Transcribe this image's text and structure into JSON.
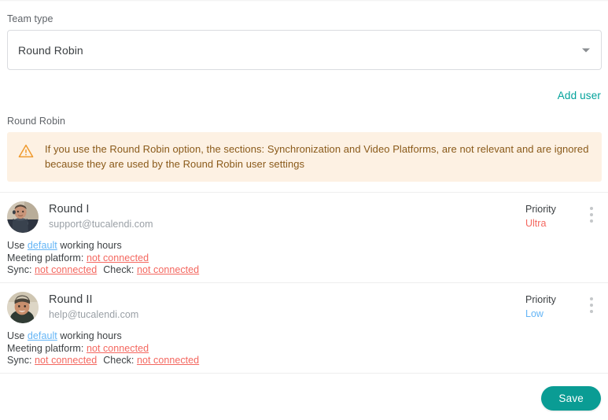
{
  "colors": {
    "accent_teal": "#0a9c94",
    "link_teal": "#00a19a",
    "warning_bg": "#fdf1e3",
    "warning_text": "#8a5a1a",
    "warning_icon": "#ef9a2e",
    "danger": "#f4675f",
    "info_blue": "#64b5f6",
    "muted": "#9aa0a6",
    "border": "#dadce0"
  },
  "team_type": {
    "label": "Team type",
    "selected": "Round Robin",
    "options": [
      "Round Robin"
    ],
    "arrow_icon": "chevron-down-icon"
  },
  "actions": {
    "add_user_label": "Add user"
  },
  "section": {
    "title": "Round Robin"
  },
  "warning": {
    "icon": "warning-triangle-icon",
    "text": "If you use the Round Robin option, the sections: Synchronization and Video Platforms, are not relevant and are ignored because they are used by the Round Robin user settings"
  },
  "meta_labels": {
    "use": "Use",
    "default": "default",
    "working_hours": "working hours",
    "meeting_platform": "Meeting platform:",
    "sync": "Sync:",
    "check": "Check:",
    "not_connected": "not connected",
    "priority": "Priority",
    "kebab_icon": "more-vertical-icon"
  },
  "users": [
    {
      "name": "Round I",
      "email": "support@tucalendi.com",
      "avatar_icon": "user-avatar-photo",
      "priority_label": "Priority",
      "priority_value": "Ultra",
      "priority_level": "ultra",
      "use_prefix": "Use",
      "working_hours_link": "default",
      "use_suffix": "working hours",
      "meeting_platform_label": "Meeting platform:",
      "meeting_platform_value": "not connected",
      "sync_label": "Sync:",
      "sync_value": "not connected",
      "check_label": "Check:",
      "check_value": "not connected"
    },
    {
      "name": "Round II",
      "email": "help@tucalendi.com",
      "avatar_icon": "user-avatar-photo",
      "priority_label": "Priority",
      "priority_value": "Low",
      "priority_level": "low",
      "use_prefix": "Use",
      "working_hours_link": "default",
      "use_suffix": "working hours",
      "meeting_platform_label": "Meeting platform:",
      "meeting_platform_value": "not connected",
      "sync_label": "Sync:",
      "sync_value": "not connected",
      "check_label": "Check:",
      "check_value": "not connected"
    }
  ],
  "footer": {
    "save_label": "Save"
  }
}
